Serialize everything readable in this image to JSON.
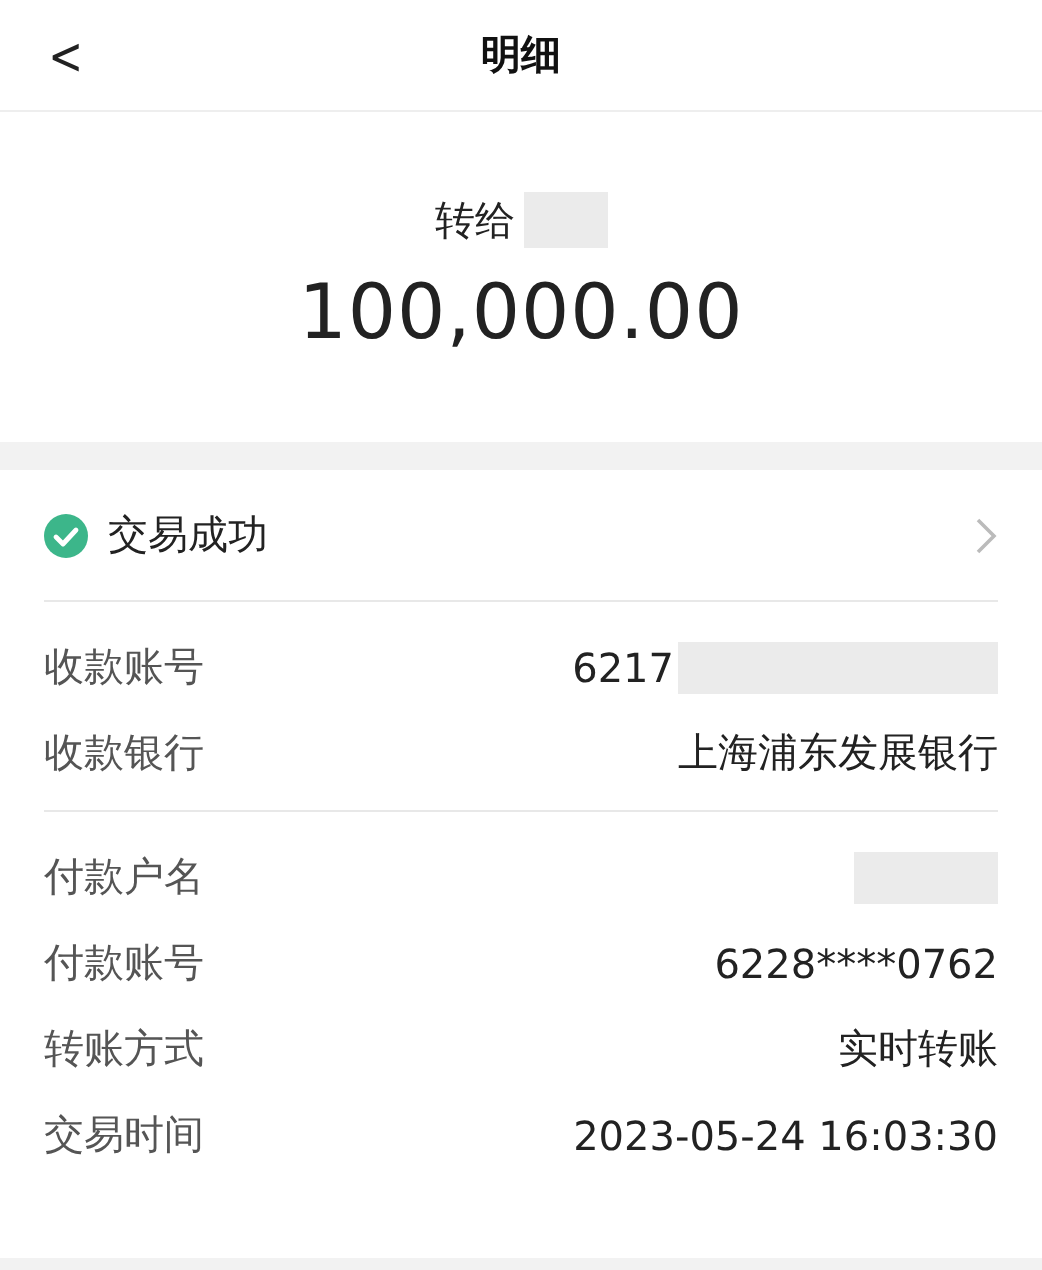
{
  "header": {
    "back": "<",
    "title": "明细"
  },
  "summary": {
    "label": "转给",
    "recipient_redacted": true,
    "amount": "100,000.00"
  },
  "status": {
    "text": "交易成功",
    "success": true
  },
  "groups": [
    {
      "rows": [
        {
          "label": "收款账号",
          "value": "6217",
          "redacted": true
        },
        {
          "label": "收款银行",
          "value": "上海浦东发展银行",
          "redacted": false
        }
      ]
    },
    {
      "rows": [
        {
          "label": "付款户名",
          "value": "",
          "redacted": true
        },
        {
          "label": "付款账号",
          "value": "6228****0762",
          "redacted": false
        },
        {
          "label": "转账方式",
          "value": "实时转账",
          "redacted": false
        },
        {
          "label": "交易时间",
          "value": "2023-05-24 16:03:30",
          "redacted": false
        }
      ]
    }
  ]
}
